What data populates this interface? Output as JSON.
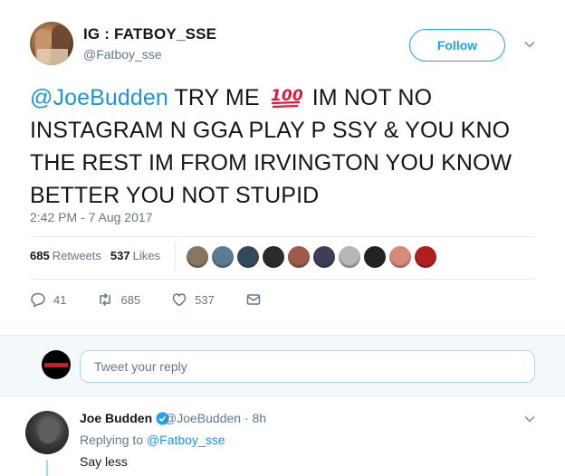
{
  "tweet": {
    "display_name": "IG : FATBOY_SSE",
    "handle": "@Fatboy_sse",
    "follow_label": "Follow",
    "text_mention": "@JoeBudden",
    "text_part1": " TRY ME ",
    "emoji_name": "hundred-points-emoji",
    "emoji_text": "100",
    "text_part2": " IM NOT NO INSTAGRAM N GGA PLAY P   SSY & YOU KNO THE REST IM FROM IRVINGTON YOU KNOW BETTER YOU NOT STUPID",
    "timestamp": "2:42 PM - 7 Aug 2017",
    "retweets_count": "685",
    "retweets_label": "Retweets",
    "likes_count": "537",
    "likes_label": "Likes",
    "likers": [
      "#8a7560",
      "#5e7c8f",
      "#334a5c",
      "#2b2b2b",
      "#a05a4a",
      "#3b3f57",
      "#b7b7b7",
      "#222222",
      "#d88a78",
      "#b01e1e"
    ],
    "actions": {
      "reply_count": "41",
      "retweet_count": "685",
      "like_count": "537"
    }
  },
  "reply_box": {
    "placeholder": "Tweet your reply"
  },
  "reply": {
    "name": "Joe Budden",
    "handle_time": "@JoeBudden · 8h",
    "replying_prefix": "Replying to ",
    "replying_handle": "@Fatboy_sse",
    "text": "Say less"
  },
  "colors": {
    "accent": "#1da1f2",
    "link": "#1b95e0",
    "muted": "#657786",
    "emoji_red": "#e0193b"
  }
}
